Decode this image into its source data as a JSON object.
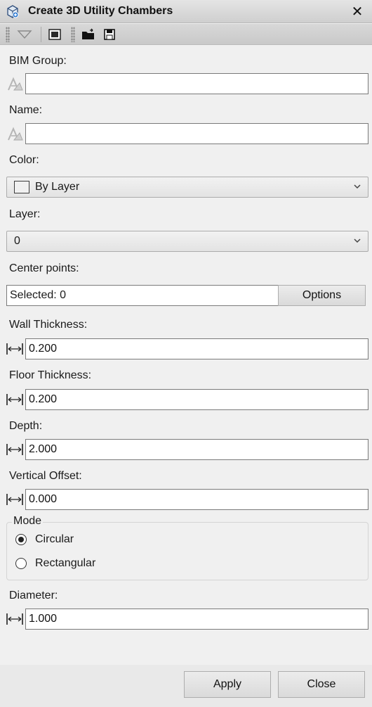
{
  "window": {
    "title": "Create 3D Utility Chambers",
    "close_glyph": "✕"
  },
  "toolbar": {
    "icons": [
      "filter-icon",
      "window-icon",
      "open-folder-icon",
      "save-icon"
    ]
  },
  "bim_group": {
    "label": "BIM Group:",
    "value": ""
  },
  "name": {
    "label": "Name:",
    "value": ""
  },
  "color": {
    "label": "Color:",
    "selected": "By Layer",
    "swatch_color": "#f0f0f0"
  },
  "layer": {
    "label": "Layer:",
    "selected": "0"
  },
  "center_points": {
    "label": "Center points:",
    "selected_text": "Selected: 0",
    "options_label": "Options"
  },
  "wall_thickness": {
    "label": "Wall Thickness:",
    "value": "0.200"
  },
  "floor_thickness": {
    "label": "Floor Thickness:",
    "value": "0.200"
  },
  "depth": {
    "label": "Depth:",
    "value": "2.000"
  },
  "vertical_offset": {
    "label": "Vertical Offset:",
    "value": "0.000"
  },
  "mode": {
    "label": "Mode",
    "options": [
      {
        "label": "Circular",
        "checked": true
      },
      {
        "label": "Rectangular",
        "checked": false
      }
    ]
  },
  "diameter": {
    "label": "Diameter:",
    "value": "1.000"
  },
  "footer": {
    "apply_label": "Apply",
    "close_label": "Close"
  }
}
